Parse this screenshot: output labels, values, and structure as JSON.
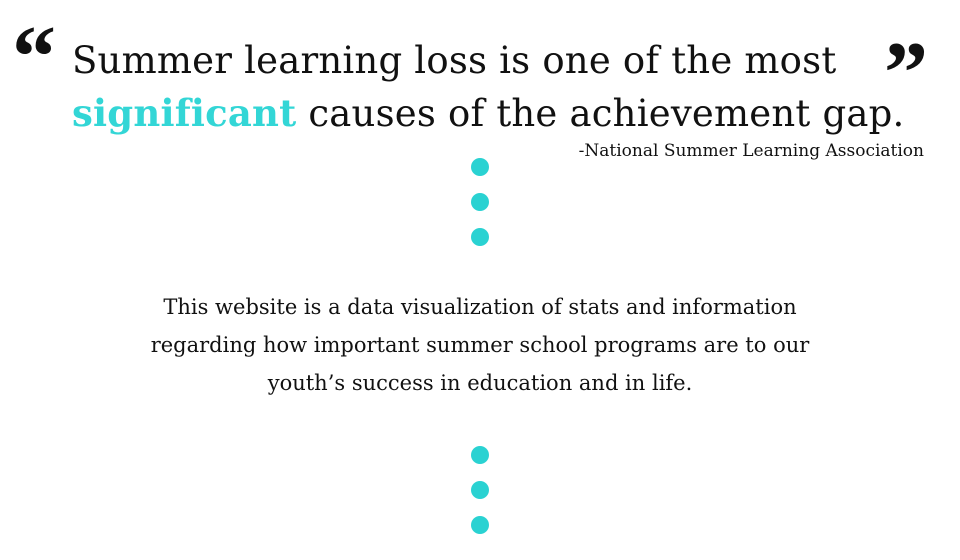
{
  "quote": {
    "open_mark": "“",
    "close_mark": "”",
    "line1": "Summer learning loss is one of the most",
    "line2_highlight": "significant",
    "line2_rest": " causes of the achievement gap.",
    "attribution": "-National Summer Learning Association"
  },
  "description": {
    "line1": "This website is a data visualization of stats and information",
    "line2": "regarding how important summer school programs are to our",
    "line3": "youth’s success in education and in life."
  },
  "colors": {
    "accent": "#2ad2d2",
    "text": "#111111",
    "background": "#ffffff"
  }
}
